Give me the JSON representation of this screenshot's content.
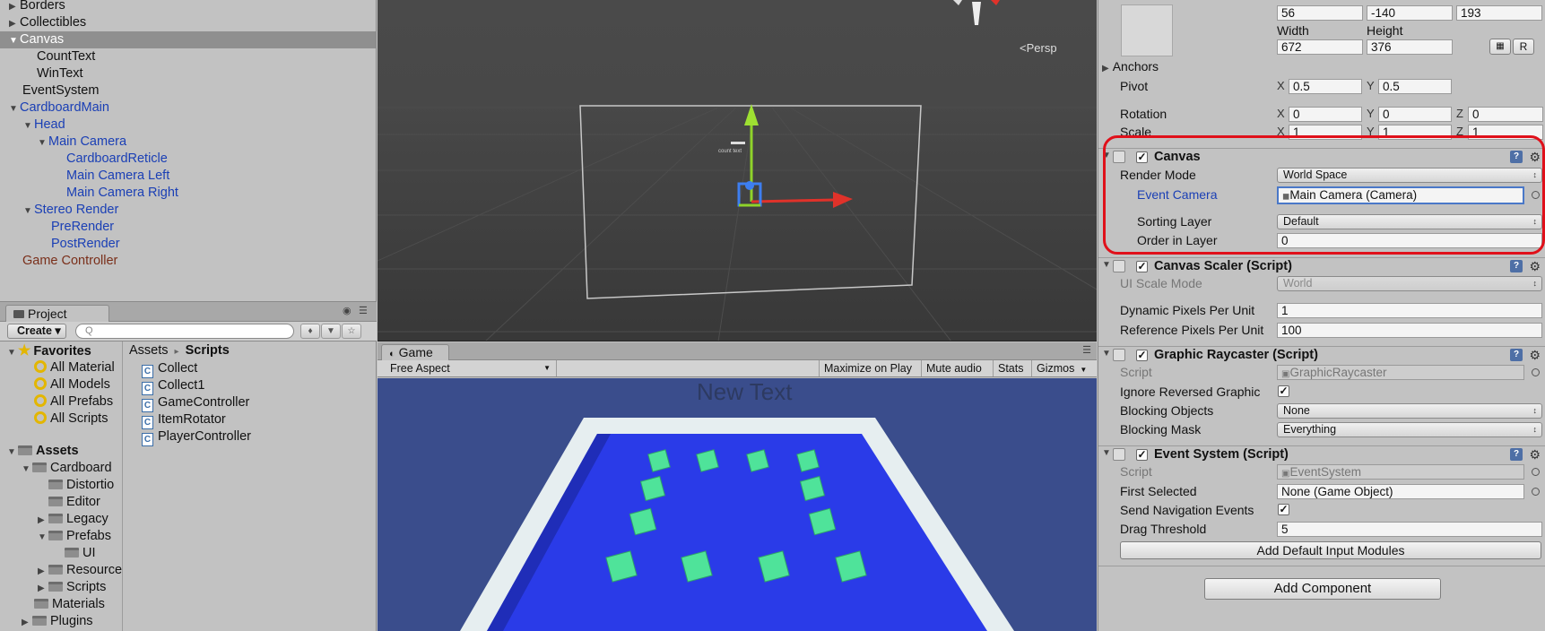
{
  "hierarchy": {
    "items": [
      {
        "label": "Borders",
        "expand": "▶"
      },
      {
        "label": "Collectibles",
        "expand": "▶"
      },
      {
        "label": "Canvas",
        "expand": "▼"
      },
      {
        "label": "CountText",
        "expand": ""
      },
      {
        "label": "WinText",
        "expand": ""
      },
      {
        "label": "EventSystem",
        "expand": ""
      },
      {
        "label": "CardboardMain",
        "expand": "▼"
      },
      {
        "label": "Head",
        "expand": "▼"
      },
      {
        "label": "Main Camera",
        "expand": "▼"
      },
      {
        "label": "CardboardReticle",
        "expand": ""
      },
      {
        "label": "Main Camera Left",
        "expand": ""
      },
      {
        "label": "Main Camera Right",
        "expand": ""
      },
      {
        "label": "Stereo Render",
        "expand": "▼"
      },
      {
        "label": "PreRender",
        "expand": ""
      },
      {
        "label": "PostRender",
        "expand": ""
      },
      {
        "label": "Game Controller",
        "expand": ""
      }
    ],
    "selected": "Canvas"
  },
  "project": {
    "tab_label": "Project",
    "create_label": "Create ▾",
    "search_placeholder": "Q",
    "breadcrumb_root": "Assets",
    "breadcrumb_sep": "▸",
    "breadcrumb_current": "Scripts",
    "favorites": {
      "label": "Favorites",
      "items": [
        "All Material",
        "All Models",
        "All Prefabs",
        "All Scripts"
      ]
    },
    "assets_tree": [
      {
        "label": "Assets",
        "expand": "▼"
      },
      {
        "label": "Cardboard",
        "expand": "▼"
      },
      {
        "label": "Distortio",
        "expand": ""
      },
      {
        "label": "Editor",
        "expand": ""
      },
      {
        "label": "Legacy",
        "expand": "▶"
      },
      {
        "label": "Prefabs",
        "expand": "▼"
      },
      {
        "label": "UI",
        "expand": ""
      },
      {
        "label": "Resource",
        "expand": "▶"
      },
      {
        "label": "Scripts",
        "expand": "▶"
      },
      {
        "label": "Materials",
        "expand": ""
      },
      {
        "label": "Plugins",
        "expand": "▶"
      }
    ],
    "scripts": [
      "Collect",
      "Collect1",
      "GameController",
      "ItemRotator",
      "PlayerController"
    ]
  },
  "scene": {
    "persp_label": "Persp",
    "count_text_label": "count text"
  },
  "game": {
    "tab_label": "Game",
    "aspect": "Free Aspect",
    "toolbar": [
      "Maximize on Play",
      "Mute audio",
      "Stats",
      "Gizmos"
    ],
    "new_text": "New Text"
  },
  "inspector": {
    "rect": {
      "pos_values": [
        "56",
        "-140",
        "193"
      ],
      "width_label": "Width",
      "height_label": "Height",
      "width": "672",
      "height": "376",
      "r_label": "R"
    },
    "anchors_label": "Anchors",
    "pivot": {
      "label": "Pivot",
      "x": "0.5",
      "y": "0.5"
    },
    "rotation": {
      "label": "Rotation",
      "x": "0",
      "y": "0",
      "z": "0"
    },
    "scale": {
      "label": "Scale",
      "x": "1",
      "y": "1",
      "z": "1"
    },
    "axis": {
      "x": "X",
      "y": "Y",
      "z": "Z"
    },
    "canvas": {
      "title": "Canvas",
      "render_mode_label": "Render Mode",
      "render_mode": "World Space",
      "event_camera_label": "Event Camera",
      "event_camera": "Main Camera (Camera)",
      "sorting_layer_label": "Sorting Layer",
      "sorting_layer": "Default",
      "order_label": "Order in Layer",
      "order": "0"
    },
    "canvas_scaler": {
      "title": "Canvas Scaler (Script)",
      "ui_scale_label": "UI Scale Mode",
      "ui_scale": "World",
      "dyn_label": "Dynamic Pixels Per Unit",
      "dyn": "1",
      "ref_label": "Reference Pixels Per Unit",
      "ref": "100"
    },
    "graphic_raycaster": {
      "title": "Graphic Raycaster (Script)",
      "script_label": "Script",
      "script": "GraphicRaycaster",
      "ignore_label": "Ignore Reversed Graphic",
      "blocking_objects_label": "Blocking Objects",
      "blocking_objects": "None",
      "blocking_mask_label": "Blocking Mask",
      "blocking_mask": "Everything"
    },
    "event_system": {
      "title": "Event System (Script)",
      "script_label": "Script",
      "script": "EventSystem",
      "first_selected_label": "First Selected",
      "first_selected": "None (Game Object)",
      "send_nav_label": "Send Navigation Events",
      "drag_label": "Drag Threshold",
      "drag": "5",
      "add_modules_label": "Add Default Input Modules"
    },
    "add_component_label": "Add Component"
  },
  "colors": {
    "highlight": "#e0101a",
    "selection": "#8f8f8f",
    "hierarchy_blue": "#1a3fb5",
    "hierarchy_brown": "#7a2f1a",
    "game_floor": "#2a3be8",
    "collectible": "#4fe39a"
  }
}
